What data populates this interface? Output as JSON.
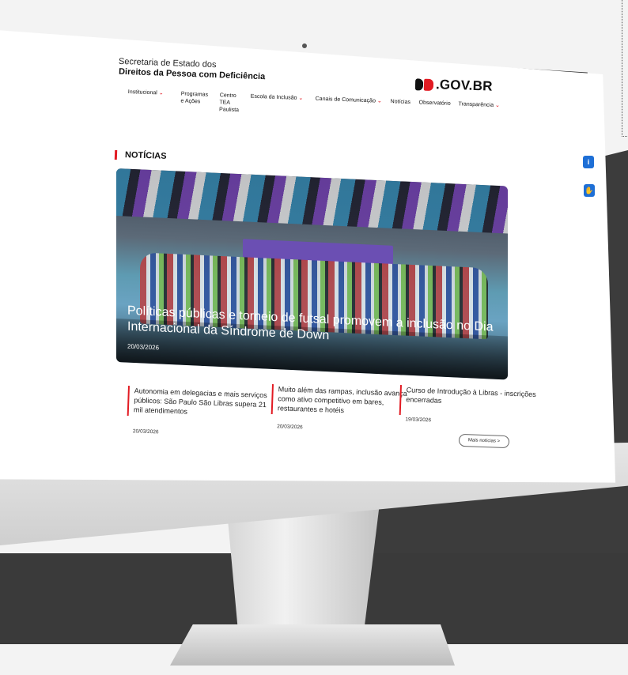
{
  "header": {
    "org_line1": "Secretaria de Estado dos",
    "org_line2": "Direitos da Pessoa com Deficiência",
    "logo_text": ".GOV.BR"
  },
  "nav": {
    "items": [
      {
        "label": "Institucional",
        "has_dropdown": true
      },
      {
        "label": "Programas\ne Ações",
        "has_dropdown": false
      },
      {
        "label": "Centro\nTEA\nPaulista",
        "has_dropdown": false
      },
      {
        "label": "Escola da Inclusão",
        "has_dropdown": true
      },
      {
        "label": "Canais de Comunicação",
        "has_dropdown": true
      },
      {
        "label": "Notícias",
        "has_dropdown": false
      },
      {
        "label": "Observatório",
        "has_dropdown": false
      },
      {
        "label": "Transparência",
        "has_dropdown": true
      }
    ],
    "dropdown_glyph": "⌄"
  },
  "section": {
    "title": "NOTÍCIAS"
  },
  "hero": {
    "title": "Políticas públicas e torneio de futsal promovem a inclusão no Dia Internacional da Síndrome de Down",
    "date": "20/03/2026"
  },
  "news": [
    {
      "text": "Autonomia em delegacias e mais serviços públicos: São Paulo São Libras supera 21 mil atendimentos",
      "date": "20/03/2026"
    },
    {
      "text": "Muito além das rampas, inclusão avança como ativo competitivo em bares, restaurantes e hotéis",
      "date": "20/03/2026"
    },
    {
      "text": "Curso de Introdução à Libras - inscrições encerradas",
      "date": "19/03/2026"
    }
  ],
  "more_button": "Mais notícias  >",
  "side_buttons": {
    "info_icon": "info-icon",
    "libras_icon": "hand-icon",
    "info_glyph": "i",
    "libras_glyph": "✋"
  },
  "colors": {
    "accent": "#e21b23",
    "side_button": "#1e6fd6"
  }
}
